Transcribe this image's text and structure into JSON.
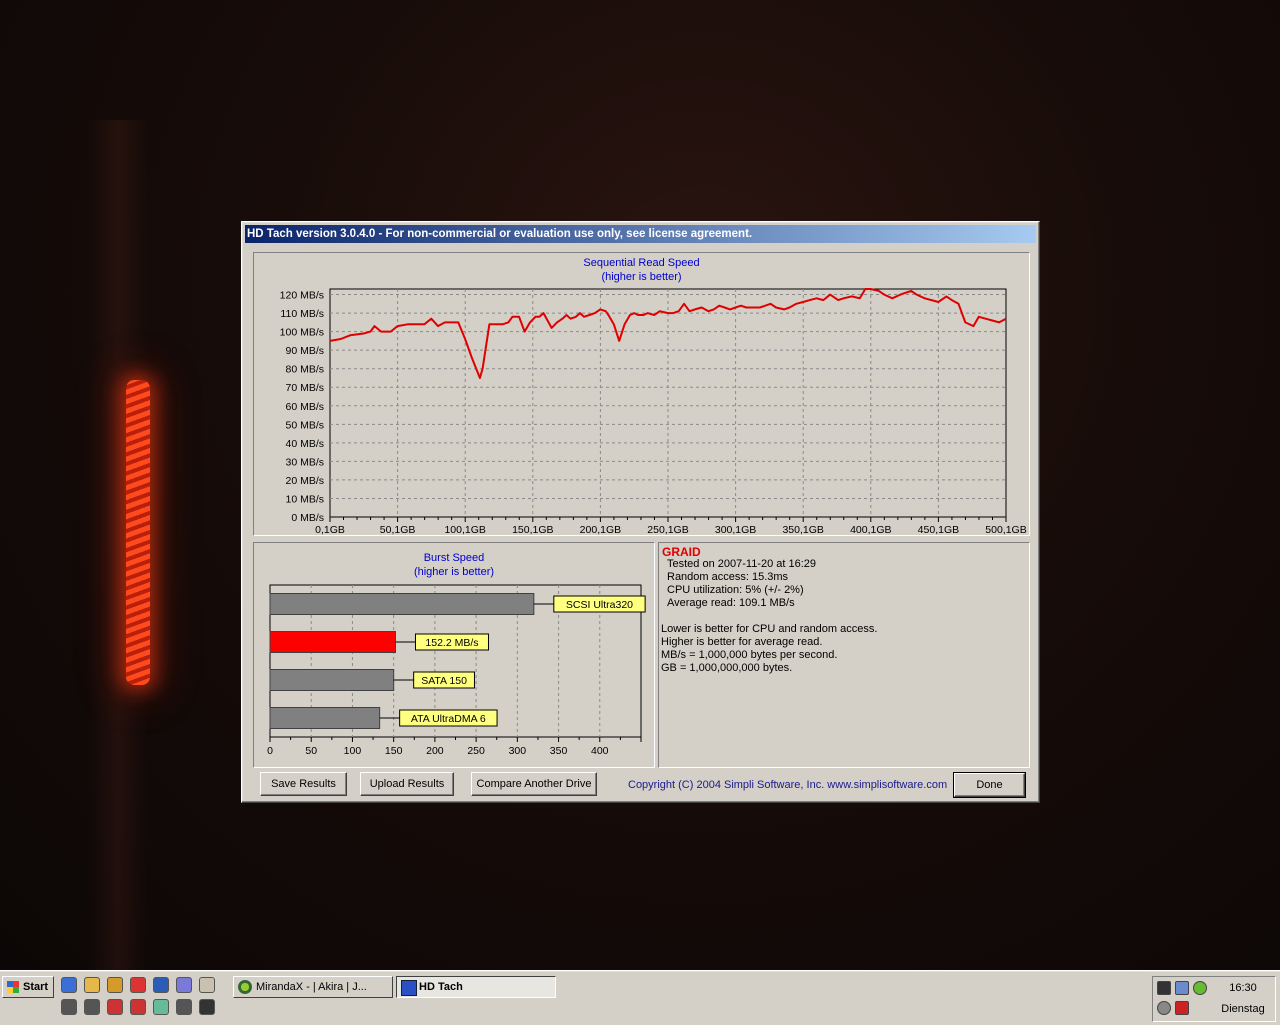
{
  "window": {
    "title": "HD Tach version 3.0.4.0  - For non-commercial or evaluation use only, see license agreement."
  },
  "chart_data": [
    {
      "type": "line",
      "title": "Sequential Read Speed",
      "subtitle": "(higher is better)",
      "x_tick_labels": [
        "0,1GB",
        "50,1GB",
        "100,1GB",
        "150,1GB",
        "200,1GB",
        "250,1GB",
        "300,1GB",
        "350,1GB",
        "400,1GB",
        "450,1GB",
        "500,1GB"
      ],
      "y_tick_labels": [
        "0 MB/s",
        "10 MB/s",
        "20 MB/s",
        "30 MB/s",
        "40 MB/s",
        "50 MB/s",
        "60 MB/s",
        "70 MB/s",
        "80 MB/s",
        "90 MB/s",
        "100 MB/s",
        "110 MB/s",
        "120 MB/s"
      ],
      "xlim": [
        0.1,
        500.1
      ],
      "ylim": [
        0,
        123
      ],
      "grid": true,
      "series": [
        {
          "color": "#e00000",
          "x": [
            0.1,
            8,
            15,
            25,
            30,
            33,
            38,
            45,
            50,
            58,
            62,
            65,
            70,
            75,
            80,
            85,
            95,
            100,
            105,
            111,
            113,
            118,
            122,
            128,
            132,
            135,
            140,
            144,
            148,
            152,
            155,
            158,
            164,
            168,
            172,
            175,
            178,
            182,
            185,
            188,
            192,
            196,
            200,
            204,
            206,
            210,
            214,
            218,
            222,
            225,
            228,
            232,
            235,
            240,
            244,
            250,
            254,
            258,
            262,
            266,
            270,
            275,
            280,
            284,
            288,
            292,
            296,
            300,
            304,
            308,
            312,
            318,
            322,
            326,
            330,
            336,
            340,
            345,
            350,
            355,
            360,
            365,
            370,
            376,
            380,
            386,
            392,
            396,
            400,
            406,
            410,
            416,
            422,
            426,
            430,
            434,
            440,
            445,
            450,
            456,
            460,
            465,
            470,
            476,
            480,
            485,
            490,
            495,
            500.1
          ],
          "y": [
            95,
            96,
            98,
            99,
            100,
            103,
            100,
            100,
            103,
            104,
            104,
            104,
            104,
            107,
            103,
            105,
            105,
            96,
            86,
            75,
            80,
            104,
            104,
            104,
            105,
            108,
            108,
            100,
            105,
            108,
            108,
            110,
            102,
            105,
            107,
            109,
            107,
            108,
            110,
            108,
            109,
            110,
            112,
            111,
            109,
            104,
            95,
            104,
            109,
            110,
            109,
            109,
            110,
            109,
            111,
            110,
            110,
            111,
            115,
            111,
            112,
            113,
            111,
            112,
            114,
            113,
            112,
            113,
            114,
            113,
            113,
            113,
            114,
            115,
            113,
            112,
            113,
            115,
            116,
            117,
            118,
            117,
            120,
            117,
            118,
            119,
            118,
            123,
            123,
            122,
            120,
            118,
            120,
            121,
            122,
            120,
            118,
            117,
            116,
            119,
            117,
            115,
            105,
            103,
            108,
            107,
            106,
            105,
            107
          ]
        }
      ]
    },
    {
      "type": "bar",
      "orientation": "horizontal",
      "title": "Burst Speed",
      "subtitle": "(higher is better)",
      "x_tick_labels": [
        "0",
        "50",
        "100",
        "150",
        "200",
        "250",
        "300",
        "350",
        "400"
      ],
      "xlim": [
        0,
        450
      ],
      "grid": true,
      "bars": [
        {
          "label": "SCSI Ultra320",
          "value": 320,
          "color": "#808080"
        },
        {
          "label": "152.2 MB/s",
          "value": 152.2,
          "color": "#ff0000"
        },
        {
          "label": "SATA 150",
          "value": 150,
          "color": "#808080"
        },
        {
          "label": "ATA UltraDMA 6",
          "value": 133,
          "color": "#808080"
        }
      ]
    }
  ],
  "info": {
    "title": "GRAID",
    "tested": "Tested on 2007-11-20 at 16:29",
    "random_access": "Random access: 15.3ms",
    "cpu": "CPU utilization: 5% (+/- 2%)",
    "average_read": "Average read: 109.1 MB/s",
    "note1": "Lower is better for CPU and random access.",
    "note2": "Higher is better for average read.",
    "note3": "MB/s = 1,000,000 bytes per second.",
    "note4": "GB = 1,000,000,000 bytes."
  },
  "buttons": {
    "save": "Save Results",
    "upload": "Upload Results",
    "compare": "Compare Another Drive",
    "done": "Done"
  },
  "copyright": "Copyright (C) 2004 Simpli Software, Inc. www.simplisoftware.com",
  "taskbar": {
    "start": "Start",
    "tasks": [
      {
        "label": "MirandaX - | Akira | J...",
        "icon": "miranda-icon"
      },
      {
        "label": "HD Tach",
        "icon": "hdtach-icon"
      }
    ],
    "clock": "16:30",
    "day": "Dienstag",
    "quicklaunch_icons": [
      "ie-icon",
      "mail-icon",
      "app-icon",
      "opera-icon",
      "word-icon",
      "app-icon",
      "app-icon",
      "app-icon",
      "app-icon",
      "app-icon",
      "app-icon",
      "app-icon",
      "app-icon",
      "steam-icon"
    ]
  }
}
